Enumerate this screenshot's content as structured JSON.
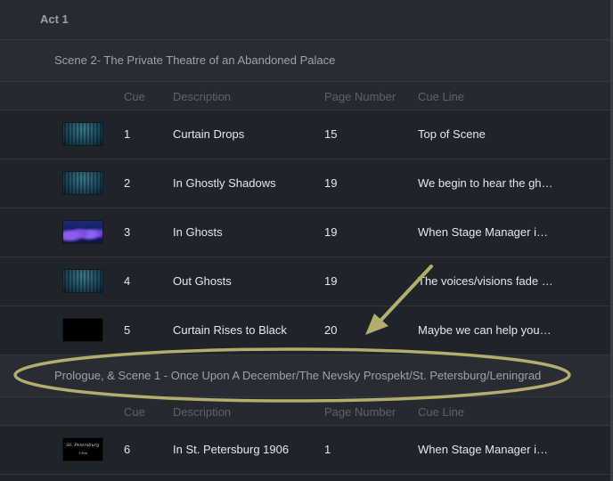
{
  "act": {
    "title": "Act 1"
  },
  "columns": {
    "cue": "Cue",
    "description": "Description",
    "page": "Page Number",
    "cue_line": "Cue Line"
  },
  "scenes": [
    {
      "title": "Scene 2- The Private Theatre of an Abandoned Palace",
      "cues": [
        {
          "cue": "1",
          "description": "Curtain Drops",
          "page": "15",
          "cue_line": "Top of Scene",
          "thumbnail": "curtain-thumbnail"
        },
        {
          "cue": "2",
          "description": "In Ghostly Shadows",
          "page": "19",
          "cue_line": "We begin to hear the ghosts",
          "thumbnail": "curtain-thumbnail"
        },
        {
          "cue": "3",
          "description": "In Ghosts",
          "page": "19",
          "cue_line": "When Stage Manager is ready",
          "thumbnail": "ghosts-thumbnail"
        },
        {
          "cue": "4",
          "description": "Out Ghosts",
          "page": "19",
          "cue_line": "The voices/visions fade away",
          "thumbnail": "curtain-thumbnail"
        },
        {
          "cue": "5",
          "description": "Curtain Rises to Black",
          "page": "20",
          "cue_line": "Maybe we can help you find",
          "thumbnail": "black-thumbnail"
        }
      ]
    },
    {
      "title": "Prologue, & Scene 1 - Once Upon A December/The Nevsky Prospekt/St. Petersburg/Leningrad",
      "cues": [
        {
          "cue": "6",
          "description": "In St. Petersburg 1906",
          "page": "1",
          "cue_line": "When Stage Manager is ready",
          "thumbnail": "title-card-thumbnail",
          "thumb_text": "St. Petersburg",
          "thumb_year": "1906"
        }
      ]
    }
  ],
  "colors": {
    "background": "#1f232a",
    "annotation": "#b3ae6e"
  }
}
